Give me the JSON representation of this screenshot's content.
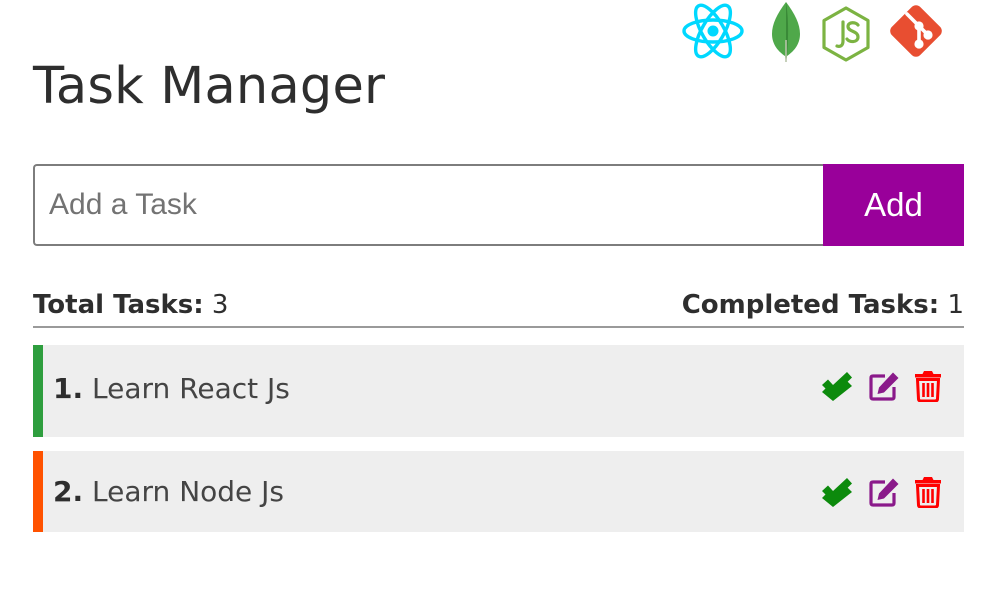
{
  "header": {
    "logos": [
      {
        "icon": "react-logo-icon",
        "color": "#00d8ff"
      },
      {
        "icon": "mongodb-leaf-icon",
        "color": "#4fa84a"
      },
      {
        "icon": "nodejs-logo-icon",
        "color": "#7cb342"
      },
      {
        "icon": "git-logo-icon",
        "color": "#e84e31"
      }
    ],
    "title": "Task Manager"
  },
  "form": {
    "input_placeholder": "Add a Task",
    "input_value": "",
    "add_label": "Add",
    "add_color": "#99009a"
  },
  "counts": {
    "total_label": "Total Tasks:",
    "total_value": "3",
    "completed_label": "Completed Tasks:",
    "completed_value": "1"
  },
  "tasks": [
    {
      "number": "1.",
      "text": "Learn React Js",
      "status_color": "#2e9e3e"
    },
    {
      "number": "2.",
      "text": "Learn Node Js",
      "status_color": "#ff5200"
    }
  ],
  "actions": {
    "complete_icon": "double-check-icon",
    "complete_color": "#0c8a0c",
    "edit_icon": "edit-icon",
    "edit_color": "#8a1a8a",
    "delete_icon": "trash-icon",
    "delete_color": "#ff0000"
  }
}
